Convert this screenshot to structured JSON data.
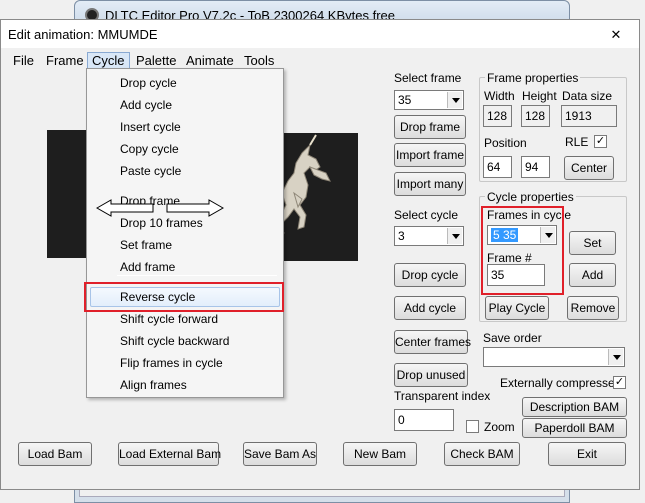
{
  "back_window": {
    "title": "DLTC Editor Pro V7.2c - ToB    2300264 KBytes free"
  },
  "dialog": {
    "title": "Edit animation: MMUMDE",
    "close_glyph": "✕"
  },
  "menubar": [
    "File",
    "Frame",
    "Cycle",
    "Palette",
    "Animate",
    "Tools"
  ],
  "cycle_menu": {
    "items_top": [
      "Drop cycle",
      "Add cycle",
      "Insert cycle",
      "Copy cycle",
      "Paste cycle",
      "Drop frame",
      "Drop 10 frames",
      "Set frame",
      "Add frame"
    ],
    "items_bottom": [
      "Reverse cycle",
      "Shift cycle forward",
      "Shift cycle backward",
      "Flip frames in cycle",
      "Align frames"
    ],
    "highlighted": "Reverse cycle"
  },
  "select_frame": {
    "label": "Select frame",
    "value": "35",
    "drop_button": "Drop frame",
    "import_frame": "Import frame",
    "import_many": "Import many"
  },
  "frame_properties": {
    "title": "Frame properties",
    "width_label": "Width",
    "width": "128",
    "height_label": "Height",
    "height": "128",
    "datasize_label": "Data size",
    "datasize": "1913",
    "position_label": "Position",
    "pos_x": "64",
    "pos_y": "94",
    "rle_label": "RLE",
    "rle_checked": "✓",
    "center_button": "Center"
  },
  "select_cycle": {
    "label": "Select cycle",
    "value": "3",
    "drop_cycle": "Drop cycle",
    "add_cycle": "Add cycle"
  },
  "cycle_properties": {
    "title": "Cycle properties",
    "frames_in_cycle_label": "Frames in cycle",
    "frames_in_cycle_value": "5 35",
    "frame_no_label": "Frame #",
    "frame_no_value": "35",
    "set_button": "Set",
    "add_button": "Add",
    "play_button": "Play Cycle",
    "remove_button": "Remove"
  },
  "center_frames": "Center frames",
  "drop_unused": "Drop unused",
  "save_order_label": "Save order",
  "externally_compressed_label": "Externally compressed",
  "externally_compressed_checked": "✓",
  "transparent_index_label": "Transparent index",
  "transparent_index_value": "0",
  "zoom_label": "Zoom",
  "description_bam": "Description BAM",
  "paperdoll_bam": "Paperdoll BAM",
  "bottom_buttons": [
    "Load Bam",
    "Load External Bam",
    "Save Bam As",
    "New Bam",
    "Check BAM",
    "Exit"
  ],
  "colors": {
    "highlight_red": "#e0202a",
    "selection_blue": "#3399ff",
    "preview_bg": "#1e1e1e"
  }
}
